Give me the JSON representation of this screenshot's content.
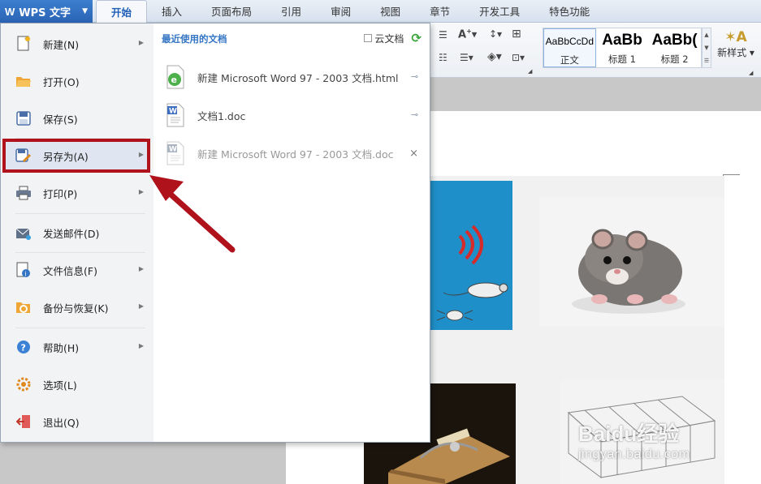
{
  "app_button": {
    "label": "WPS 文字",
    "logo": "W"
  },
  "tabs": [
    {
      "label": "开始",
      "active": true
    },
    {
      "label": "插入"
    },
    {
      "label": "页面布局"
    },
    {
      "label": "引用"
    },
    {
      "label": "审阅"
    },
    {
      "label": "视图"
    },
    {
      "label": "章节"
    },
    {
      "label": "开发工具"
    },
    {
      "label": "特色功能"
    }
  ],
  "ribbon": {
    "styles": [
      {
        "sample": "AaBbCcDd",
        "name": "正文"
      },
      {
        "sample": "AaBb",
        "name": "标题 1"
      },
      {
        "sample": "AaBb(",
        "name": "标题 2"
      }
    ],
    "new_style_label": "新样式"
  },
  "menu": {
    "items": [
      {
        "label": "新建(N)",
        "icon": "new-doc-icon",
        "submenu": true
      },
      {
        "label": "打开(O)",
        "icon": "open-folder-icon",
        "submenu": false
      },
      {
        "label": "保存(S)",
        "icon": "save-icon",
        "submenu": false
      },
      {
        "label": "另存为(A)",
        "icon": "save-as-icon",
        "submenu": true
      },
      {
        "label": "打印(P)",
        "icon": "print-icon",
        "submenu": true
      },
      {
        "label": "发送邮件(D)",
        "icon": "mail-icon",
        "submenu": false
      },
      {
        "label": "文件信息(F)",
        "icon": "file-info-icon",
        "submenu": true
      },
      {
        "label": "备份与恢复(K)",
        "icon": "backup-icon",
        "submenu": true
      },
      {
        "label": "帮助(H)",
        "icon": "help-icon",
        "submenu": true
      },
      {
        "label": "选项(L)",
        "icon": "options-icon",
        "submenu": false
      },
      {
        "label": "退出(Q)",
        "icon": "exit-icon",
        "submenu": false
      }
    ],
    "recent_title": "最近使用的文档",
    "cloud_label": "云文档",
    "recent_docs": [
      {
        "name": "新建 Microsoft Word 97 - 2003 文档.html",
        "type": "html",
        "pinned": true
      },
      {
        "name": "文档1.doc",
        "type": "doc",
        "pinned": true
      },
      {
        "name": "新建 Microsoft Word 97 - 2003 文档.doc",
        "type": "doc",
        "pinned": false
      }
    ]
  },
  "colors": {
    "accent": "#2a63b3",
    "annotation": "#b0121b",
    "menu_bg": "#f2f3f5"
  },
  "watermark": {
    "brand": "Baidu经验",
    "url": "jingyan.baidu.com"
  }
}
